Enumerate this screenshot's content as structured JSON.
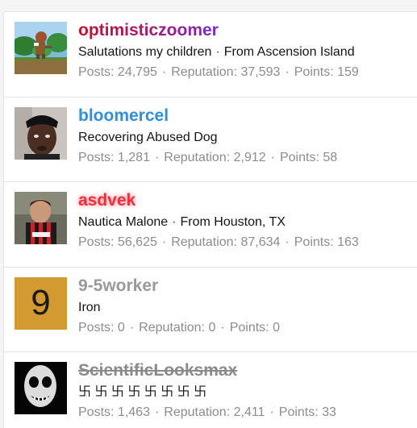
{
  "members": [
    {
      "username": "optimisticzoomer",
      "title": "Salutations my children",
      "location": "From Ascension Island",
      "posts_label": "Posts:",
      "posts": "24,795",
      "reputation_label": "Reputation:",
      "reputation": "37,593",
      "points_label": "Points:",
      "points": "159"
    },
    {
      "username": "bloomercel",
      "title": "Recovering Abused Dog",
      "posts_label": "Posts:",
      "posts": "1,281",
      "reputation_label": "Reputation:",
      "reputation": "2,912",
      "points_label": "Points:",
      "points": "58"
    },
    {
      "username": "asdvek",
      "title": "Nautica Malone",
      "location": "From Houston, TX",
      "posts_label": "Posts:",
      "posts": "56,625",
      "reputation_label": "Reputation:",
      "reputation": "87,634",
      "points_label": "Points:",
      "points": "163"
    },
    {
      "username": "9-5worker",
      "avatar_letter": "9",
      "title": "Iron",
      "posts_label": "Posts:",
      "posts": "0",
      "reputation_label": "Reputation:",
      "reputation": "0",
      "points_label": "Points:",
      "points": "0"
    },
    {
      "username": "ScientificLooksmax",
      "title": "卐 卐 卐 卐 卐 卐 卐 卐",
      "posts_label": "Posts:",
      "posts": "1,463",
      "reputation_label": "Reputation:",
      "reputation": "2,411",
      "points_label": "Points:",
      "points": "33"
    }
  ],
  "separator": "·",
  "colors": {
    "username_gradient_start": "#c8102e",
    "username_gradient_end": "#7a2bcf",
    "username_blue": "#2f8fd8",
    "username_red": "#e8333f",
    "username_grey": "#9a9a9a",
    "letter_avatar_bg": "#d49a32",
    "stats_text": "#8c8c8c"
  }
}
